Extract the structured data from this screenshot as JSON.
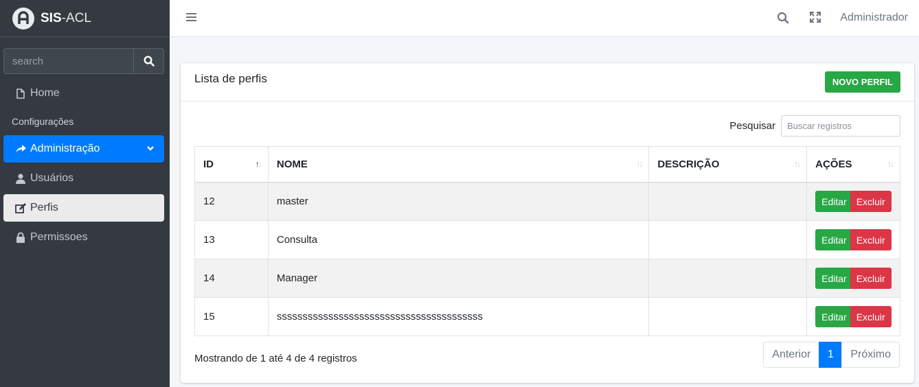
{
  "brand": {
    "bold": "SIS",
    "rest": "-ACL"
  },
  "sidebar": {
    "search_placeholder": "search",
    "home": "Home",
    "section_header": "Configurações",
    "admin": "Administração",
    "users": "Usuários",
    "profiles": "Perfis",
    "permissions": "Permissoes"
  },
  "topbar": {
    "user": "Administrador"
  },
  "card": {
    "title": "Lista de perfis",
    "new_button": "NOVO PERFIL",
    "search_label": "Pesquisar",
    "search_placeholder": "Buscar registros"
  },
  "table": {
    "headers": [
      "ID",
      "NOME",
      "DESCRIÇÃO",
      "AÇÕES"
    ],
    "rows": [
      {
        "id": "12",
        "name": "master",
        "desc": ""
      },
      {
        "id": "13",
        "name": "Consulta",
        "desc": ""
      },
      {
        "id": "14",
        "name": "Manager",
        "desc": ""
      },
      {
        "id": "15",
        "name": "ssssssssssssssssssssssssssssssssssssssss",
        "desc": ""
      }
    ],
    "edit_label": "Editar",
    "delete_label": "Excluir"
  },
  "footer": {
    "info": "Mostrando de 1 até 4 de 4 registros",
    "prev": "Anterior",
    "current_page": "1",
    "next": "Próximo"
  },
  "colors": {
    "sidebar": "#343a40",
    "primary": "#007bff",
    "success": "#28a745",
    "danger": "#dc3545"
  },
  "icons": [
    "brand-logo-icon",
    "search-icon",
    "file-icon",
    "share-icon",
    "chevron-down-icon",
    "user-icon",
    "edit-icon",
    "lock-icon",
    "bars-icon",
    "expand-icon",
    "sort-icon"
  ]
}
